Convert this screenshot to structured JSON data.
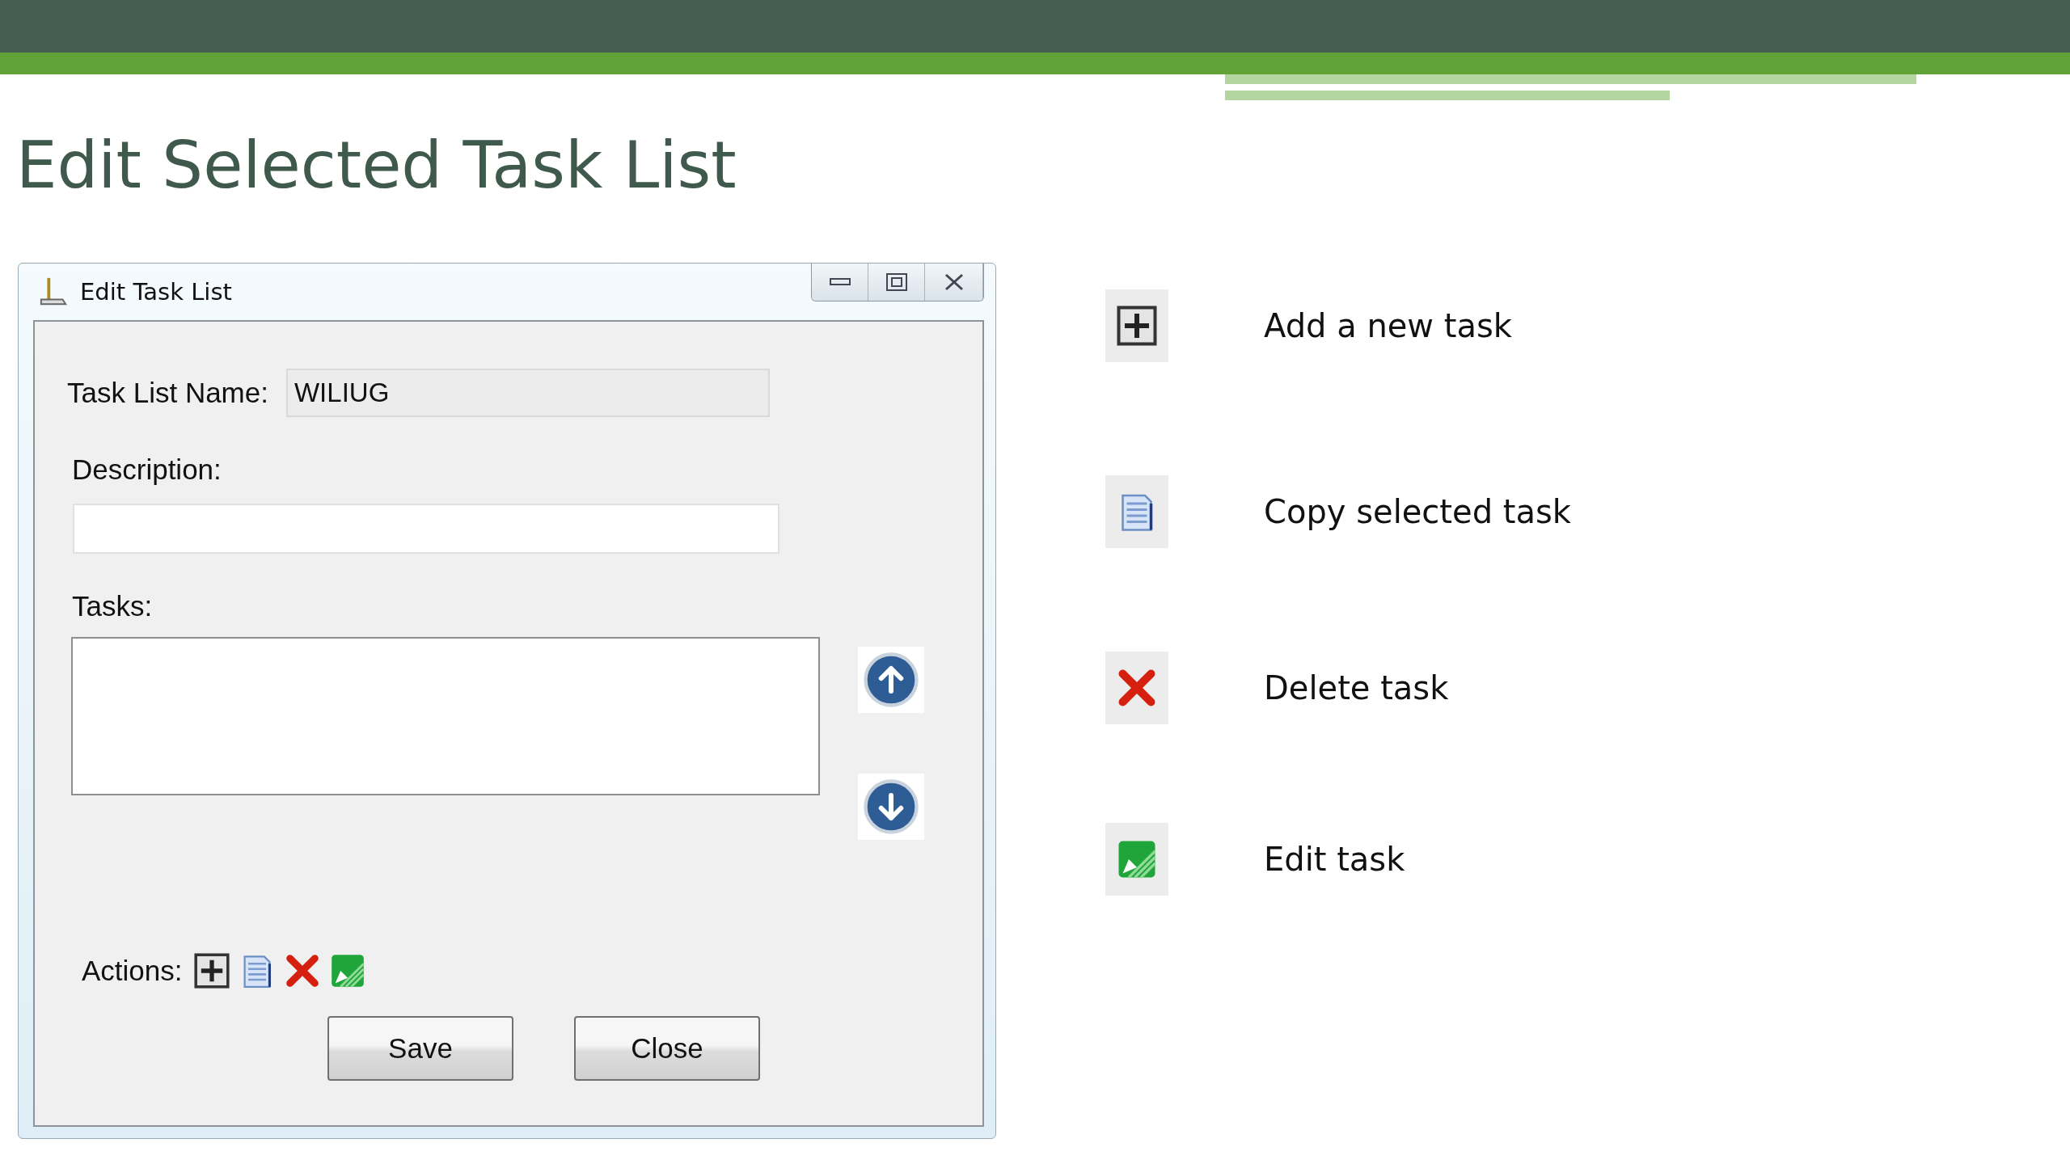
{
  "slide": {
    "title": "Edit Selected Task List"
  },
  "dialog": {
    "title": "Edit Task List",
    "name_label": "Task List Name:",
    "name_value": "WILIUG",
    "description_label": "Description:",
    "tasks_label": "Tasks:",
    "move_buttons": [
      {
        "kind": "up"
      },
      {
        "kind": "down"
      }
    ],
    "actions_label": "Actions:",
    "actions": [
      {
        "kind": "add"
      },
      {
        "kind": "copy"
      },
      {
        "kind": "delete"
      },
      {
        "kind": "edit"
      }
    ],
    "buttons": [
      "Save",
      "Close"
    ]
  },
  "legend": [
    {
      "kind": "add",
      "label": "Add a new task"
    },
    {
      "kind": "copy",
      "label": "Copy selected task"
    },
    {
      "kind": "delete",
      "label": "Delete task"
    },
    {
      "kind": "edit",
      "label": "Edit task"
    }
  ]
}
